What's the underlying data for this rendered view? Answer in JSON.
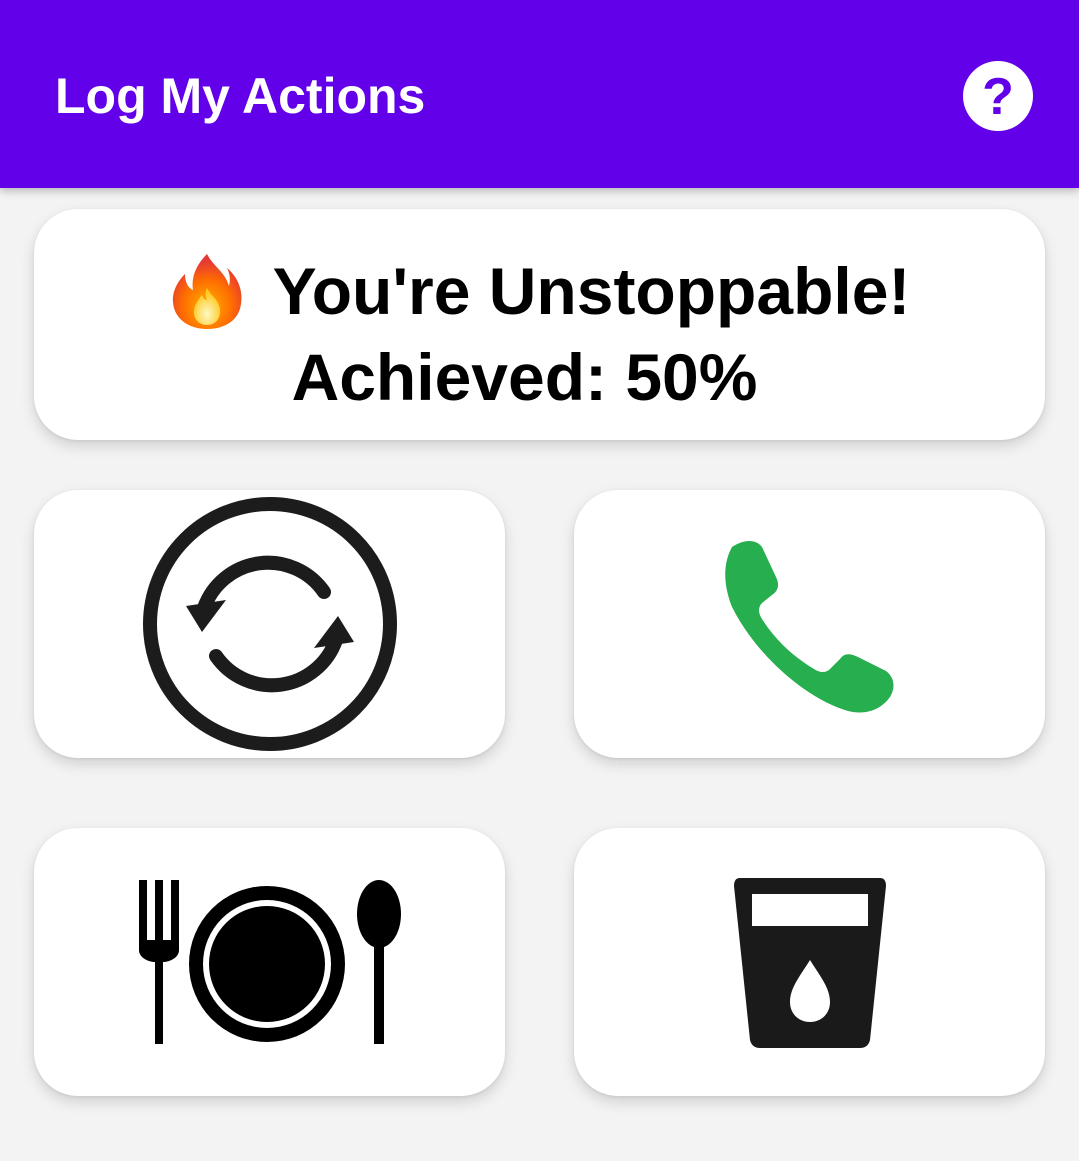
{
  "app_bar": {
    "title": "Log My Actions",
    "help_icon": "help-circle-icon",
    "help_glyph": "?",
    "color": "#6200ea"
  },
  "status": {
    "icon": "fire-icon",
    "message": "You're Unstoppable!",
    "achieved_label": "Achieved: 50%",
    "achieved_percent": 50
  },
  "actions": [
    {
      "icon": "sync-icon"
    },
    {
      "icon": "phone-icon",
      "color": "#27ae4f"
    },
    {
      "icon": "dining-icon"
    },
    {
      "icon": "water-glass-icon"
    }
  ]
}
